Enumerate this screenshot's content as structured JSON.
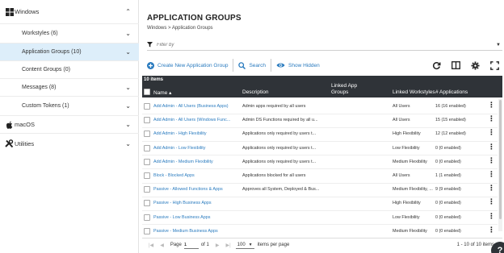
{
  "sidebar": {
    "windows_label": "Windows",
    "items": [
      {
        "label": "Workstyles (6)"
      },
      {
        "label": "Application Groups (10)"
      },
      {
        "label": "Content Groups (0)"
      },
      {
        "label": "Messages (8)"
      },
      {
        "label": "Custom Tokens (1)"
      }
    ],
    "macos_label": "macOS",
    "utilities_label": "Utilities"
  },
  "main": {
    "title": "APPLICATION GROUPS",
    "breadcrumb": "Windows > Application Groups",
    "filter_placeholder": "Filter by"
  },
  "toolbar": {
    "create_label": "Create New Application Group",
    "search_label": "Search",
    "show_hidden_label": "Show Hidden"
  },
  "grid": {
    "item_count": "10 items",
    "columns": {
      "name": "Name ▴",
      "description": "Description",
      "linked_app_groups": "Linked App Groups",
      "linked_workstyles": "Linked Workstyles",
      "applications": "# Applications"
    },
    "rows": [
      {
        "name": "Add Admin - All Users (Business Apps)",
        "description": "Admin apps required by all users",
        "workstyles": "All Users",
        "apps": "16 (16 enabled)"
      },
      {
        "name": "Add Admin - All Users (Windows Func...",
        "description": "Admin DS Functions required by all u...",
        "workstyles": "All Users",
        "apps": "15 (15 enabled)"
      },
      {
        "name": "Add Admin - High Flexibility",
        "description": "Applications only required by users t...",
        "workstyles": "High Flexibility",
        "apps": "12 (12 enabled)"
      },
      {
        "name": "Add Admin - Low Flexibility",
        "description": "Applications only required by users t...",
        "workstyles": "Low Flexibility",
        "apps": "0 (0 enabled)"
      },
      {
        "name": "Add Admin - Medium Flexibility",
        "description": "Applications only required by users t...",
        "workstyles": "Medium Flexibility",
        "apps": "0 (0 enabled)"
      },
      {
        "name": "Block - Blocked Apps",
        "description": "Applications blocked for all users",
        "workstyles": "All Users",
        "apps": "1 (1 enabled)"
      },
      {
        "name": "Passive - Allowed Functions & Apps",
        "description": "Approves all System, Deployed & Bus...",
        "workstyles": "Medium Flexibility, ...",
        "apps": "9 (9 enabled)"
      },
      {
        "name": "Passive - High Business Apps",
        "description": "",
        "workstyles": "High Flexibility",
        "apps": "0 (0 enabled)"
      },
      {
        "name": "Passive - Low Business Apps",
        "description": "",
        "workstyles": "Low Flexibility",
        "apps": "0 (0 enabled)"
      },
      {
        "name": "Passive - Medium Business Apps",
        "description": "",
        "workstyles": "Medium Flexibility",
        "apps": "0 (0 enabled)"
      }
    ]
  },
  "pager": {
    "page_label": "Page",
    "page_value": "1",
    "of_label": "of 1",
    "per_page_value": "100",
    "per_page_label": "items per page",
    "range_label": "1 - 10 of 10 items"
  },
  "colors": {
    "accent": "#2a7bbf",
    "active_bg": "#ddeefa",
    "header_bg": "#2f3338"
  }
}
